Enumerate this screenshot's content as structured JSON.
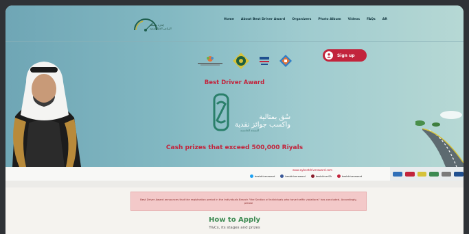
{
  "nav": {
    "items": [
      "Home",
      "About Best Driver Award",
      "Organizers",
      "Photo Album",
      "Videos",
      "FAQs",
      "AR"
    ]
  },
  "header": {
    "logo_text_line1": "إمارة منطقة",
    "logo_text_line2": "الرياض العليا لتنمية",
    "signup_label": "Sign up"
  },
  "hero": {
    "award_title": "Best Driver Award",
    "arabic_slogan_line1": "سُق بمثالية",
    "arabic_slogan_line2": "واكسب جوائز نقدية",
    "arabic_sub": "النسخة الخامسة",
    "cash_text": "Cash prizes that exceed 500,000 Riyals"
  },
  "info": {
    "site_url": "www.aybestdriveraward.com",
    "socials": [
      {
        "name": "twitter",
        "handle": "bestdriveraward",
        "color": "#1da1f2"
      },
      {
        "name": "facebook",
        "handle": "bestdriveraward",
        "color": "#3b5998"
      },
      {
        "name": "youtube",
        "handle": "bestdriverSA",
        "color": "#8b1e2d"
      },
      {
        "name": "instagram",
        "handle": "bestdriveraward",
        "color": "#c2243c"
      }
    ]
  },
  "notice": {
    "text": "Best Driver Award announces that the registration period in the Individuals Branch \"the Section of individuals who have traffic violations\" has concluded. Accordingly, please"
  },
  "how_to_apply": {
    "title": "How to Apply",
    "subtitle": "T&Cs, its stages and prizes"
  },
  "colors": {
    "accent": "#c2243c",
    "green": "#3d8a52",
    "hero_left": "#6fa6b5",
    "hero_right": "#b6d8d4"
  }
}
